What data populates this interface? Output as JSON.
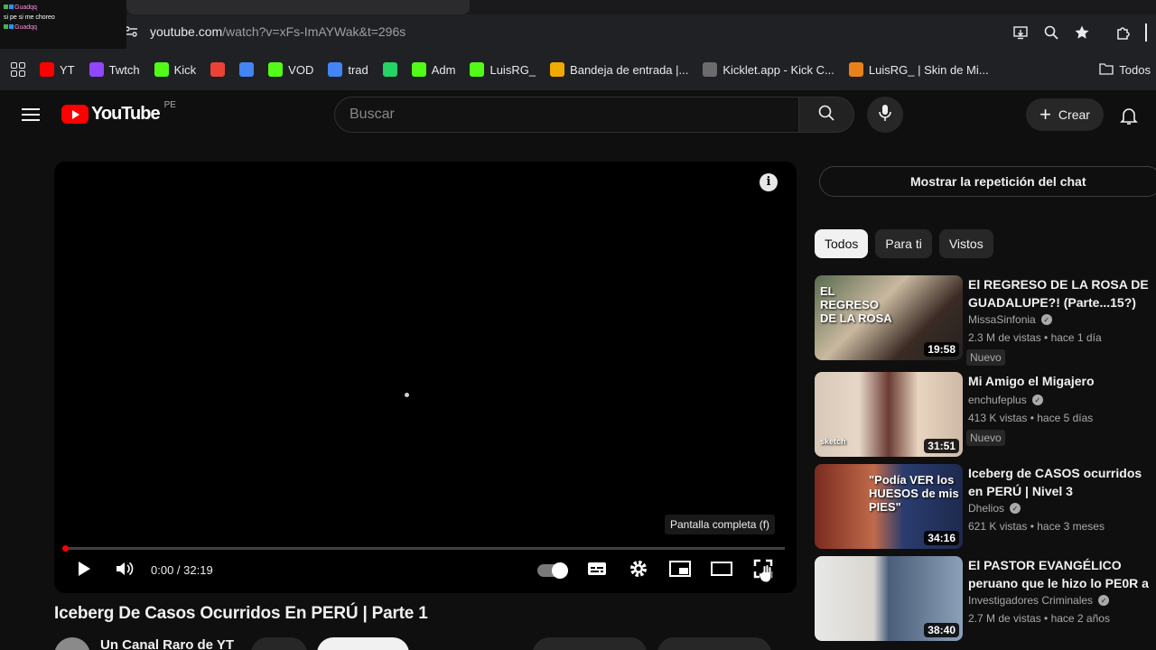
{
  "overlay_chat": {
    "line1_user": "Guadqq",
    "line2_text": "si pe si me choreo",
    "line3_user": "Guadqq"
  },
  "browser": {
    "url_host": "youtube.com",
    "url_path": "/watch?v=xFs-ImAYWak&t=296s",
    "bookmarks": [
      {
        "label": "YT",
        "icon": "youtube-icon",
        "color": "#ff0000"
      },
      {
        "label": "Twtch",
        "icon": "twitch-icon",
        "color": "#9146ff"
      },
      {
        "label": "Kick",
        "icon": "kick-icon",
        "color": "#53fc18"
      },
      {
        "label": "",
        "icon": "gmail-icon",
        "color": "#ea4335"
      },
      {
        "label": "",
        "icon": "grid-app-icon",
        "color": "#4285f4"
      },
      {
        "label": "VOD",
        "icon": "vod-icon",
        "color": "#53fc18"
      },
      {
        "label": "trad",
        "icon": "google-translate-icon",
        "color": "#4285f4"
      },
      {
        "label": "",
        "icon": "whatsapp-icon",
        "color": "#25d366"
      },
      {
        "label": "Adm",
        "icon": "kick-icon",
        "color": "#53fc18"
      },
      {
        "label": "LuisRG_",
        "icon": "kick-icon",
        "color": "#53fc18"
      },
      {
        "label": "Bandeja de entrada |...",
        "icon": "mail-icon",
        "color": "#f2a900"
      },
      {
        "label": "Kicklet.app - Kick C...",
        "icon": "kicklet-icon",
        "color": "#6b6b6b"
      },
      {
        "label": "LuisRG_ | Skin de Mi...",
        "icon": "skin-icon",
        "color": "#e8811a"
      }
    ],
    "bookmarks_folder": "Todos"
  },
  "youtube": {
    "logo_text": "YouTube",
    "country_code": "PE",
    "search_placeholder": "Buscar",
    "create_label": "Crear"
  },
  "player": {
    "tooltip": "Pantalla completa (f)",
    "time": "0:00 / 32:19",
    "progress": 0
  },
  "video": {
    "title": "Iceberg De Casos Ocurridos En PERÚ | Parte 1",
    "channel": "Un Canal Raro de YT"
  },
  "sidebar": {
    "chat_replay": "Mostrar la repetición del chat",
    "chips": [
      "Todos",
      "Para ti",
      "Vistos"
    ],
    "recommendations": [
      {
        "title": "El REGRESO DE LA ROSA DE GUADALUPE?! (Parte...15?)",
        "channel": "MissaSinfonia",
        "meta": "2.3 M de vistas • hace 1 día",
        "duration": "19:58",
        "badge": "Nuevo",
        "thumb_text": "EL REGRESO DE LA ROSA"
      },
      {
        "title": "Mi Amigo el Migajero",
        "channel": "enchufeplus",
        "meta": "413 K vistas • hace 5 días",
        "duration": "31:51",
        "badge": "Nuevo",
        "thumb_text": "sketch"
      },
      {
        "title": "Iceberg de CASOS ocurridos en PERÚ | Nivel 3",
        "channel": "Dhelios",
        "meta": "621 K vistas • hace 3 meses",
        "duration": "34:16",
        "badge": "",
        "thumb_text": "\"Podía VER los HUESOS de mis PIES\""
      },
      {
        "title": "El PASTOR EVANGÉLICO peruano que le hizo lo PE0R a ...",
        "channel": "Investigadores Criminales",
        "meta": "2.7 M de vistas • hace 2 años",
        "duration": "38:40",
        "badge": "",
        "thumb_text": ""
      }
    ]
  },
  "colors": {
    "background": "#0f0f0f",
    "chrome": "#202124",
    "accent_red": "#ff0000",
    "chip_bg": "#272727"
  }
}
